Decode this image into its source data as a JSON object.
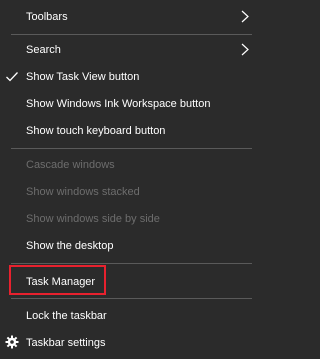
{
  "menu": {
    "items": {
      "toolbars": {
        "label": "Toolbars",
        "icon": "chevron-right-icon"
      },
      "search": {
        "label": "Search",
        "icon": "chevron-right-icon"
      },
      "show_task_view": {
        "label": "Show Task View button",
        "checked": true,
        "icon": "checkmark-icon"
      },
      "show_ink_workspace": {
        "label": "Show Windows Ink Workspace button"
      },
      "show_touch_keyboard": {
        "label": "Show touch keyboard button"
      },
      "cascade_windows": {
        "label": "Cascade windows",
        "enabled": false
      },
      "show_windows_stacked": {
        "label": "Show windows stacked",
        "enabled": false
      },
      "show_windows_side_by_side": {
        "label": "Show windows side by side",
        "enabled": false
      },
      "show_desktop": {
        "label": "Show the desktop"
      },
      "task_manager": {
        "label": "Task Manager",
        "highlighted": true
      },
      "lock_taskbar": {
        "label": "Lock the taskbar"
      },
      "taskbar_settings": {
        "label": "Taskbar settings",
        "icon": "gear-icon"
      }
    }
  },
  "colors": {
    "background": "#2b2b2b",
    "text": "#ffffff",
    "disabled_text": "#6d6d6d",
    "separator": "#5a5a5a",
    "highlight_border": "#e8212e"
  }
}
